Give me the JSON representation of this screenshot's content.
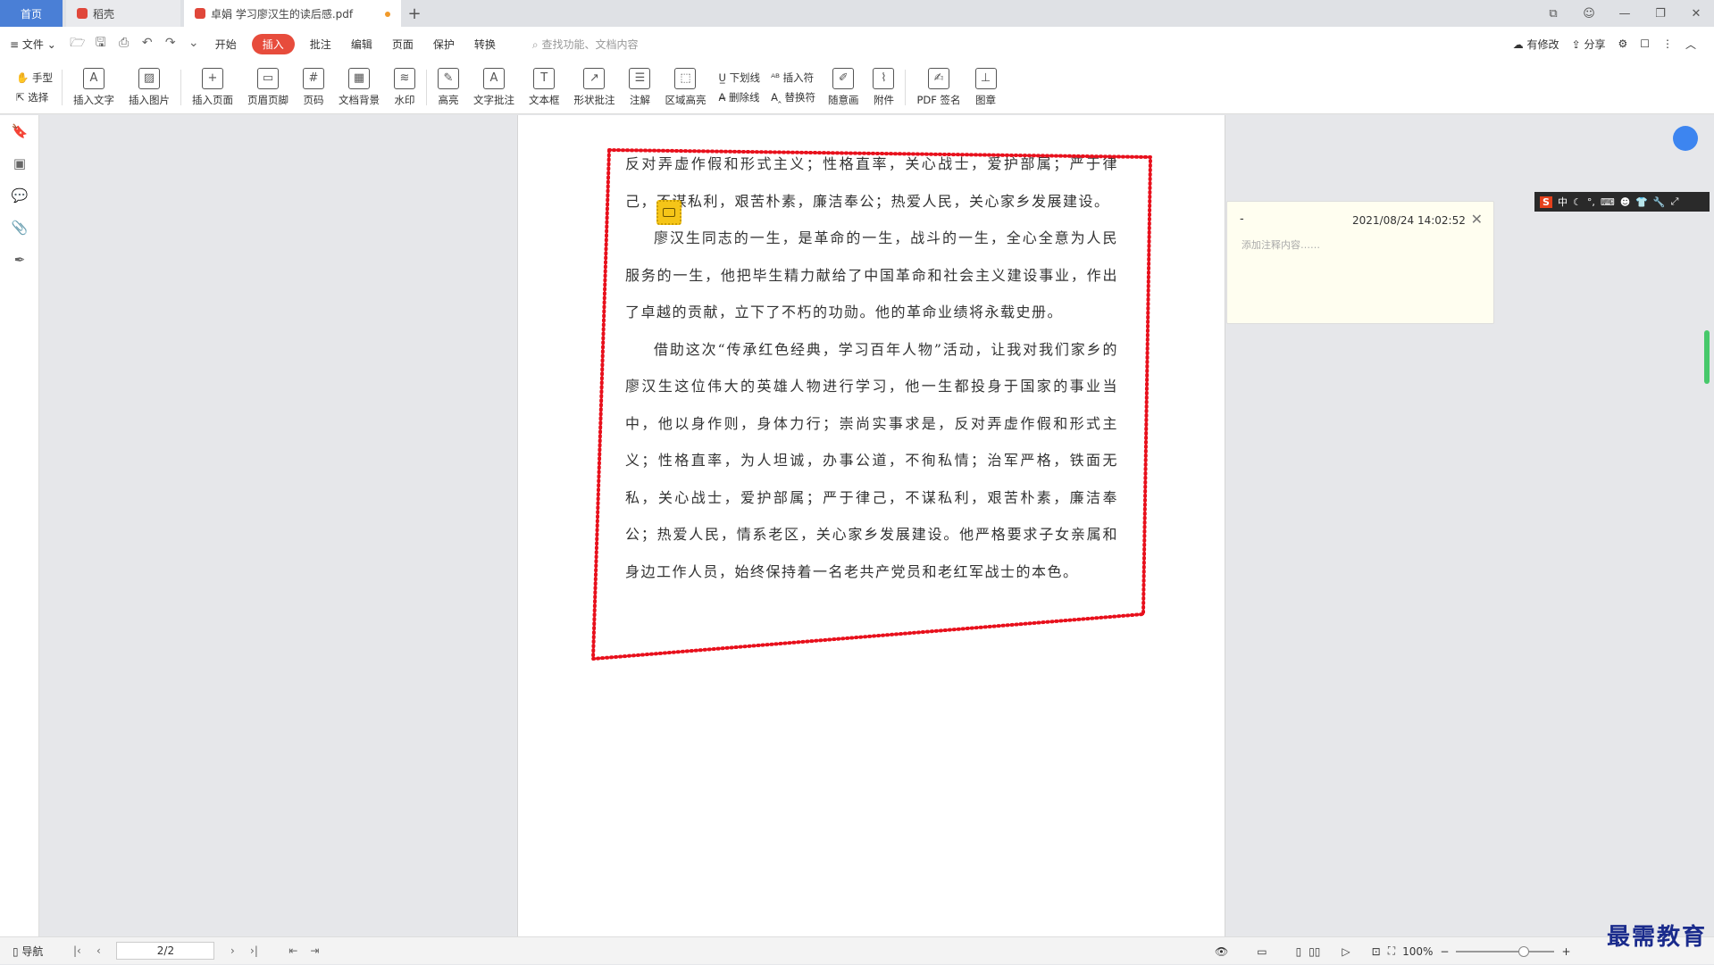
{
  "tabs": {
    "home": "首页",
    "daoke": "稻壳",
    "doc": "卓娟 学习廖汉生的读后感.pdf",
    "new": "+"
  },
  "menu": {
    "file": "文件",
    "items": [
      "开始",
      "插入",
      "批注",
      "编辑",
      "页面",
      "保护",
      "转换"
    ],
    "active_index": 1,
    "search_placeholder": "查找功能、文档内容",
    "has_edit": "有修改",
    "share": "分享"
  },
  "ribbon": {
    "hand": "手型",
    "select": "选择",
    "insert_text": "插入文字",
    "insert_image": "插入图片",
    "insert_page": "插入页面",
    "header_footer": "页眉页脚",
    "page_number": "页码",
    "doc_background": "文档背景",
    "watermark": "水印",
    "highlight": "高亮",
    "text_comment": "文字批注",
    "textbox": "文本框",
    "shape_comment": "形状批注",
    "annotation": "注解",
    "area_highlight": "区域高亮",
    "underline": "下划线",
    "strikethrough": "删除线",
    "insert_symbol": "插入符",
    "replace_symbol": "替换符",
    "freehand": "随意画",
    "attachment": "附件",
    "pdf_sign": "PDF 签名",
    "stamp": "图章"
  },
  "document": {
    "paragraphs": [
      "反对弄虚作假和形式主义；性格直率，关心战士，爱护部属；严于律己，不谋私利，艰苦朴素，廉洁奉公；热爱人民，关心家乡发展建设。",
      "廖汉生同志的一生，是革命的一生，战斗的一生，全心全意为人民服务的一生，他把毕生精力献给了中国革命和社会主义建设事业，作出了卓越的贡献，立下了不朽的功勋。他的革命业绩将永载史册。",
      "借助这次“传承红色经典，学习百年人物”活动，让我对我们家乡的廖汉生这位伟大的英雄人物进行学习，他一生都投身于国家的事业当中，他以身作则，身体力行；崇尚实事求是，反对弄虚作假和形式主义；性格直率，为人坦诚，办事公道，不徇私情；治军严格，铁面无私，关心战士，爱护部属；严于律己，不谋私利，艰苦朴素，廉洁奉公；热爱人民，情系老区，关心家乡发展建设。他严格要求子女亲属和身边工作人员，始终保持着一名老共产党员和老红军战士的本色。"
    ]
  },
  "comment": {
    "author": "-",
    "time": "2021/08/24 14:02:52",
    "placeholder": "添加注释内容……"
  },
  "status": {
    "nav": "导航",
    "page": "2/2",
    "zoom": "100%"
  },
  "watermark_text": "最需教育",
  "colors": {
    "accent_red": "#e74c3c",
    "stamp_red": "#e8101c",
    "home_tab": "#4a7fd6"
  }
}
